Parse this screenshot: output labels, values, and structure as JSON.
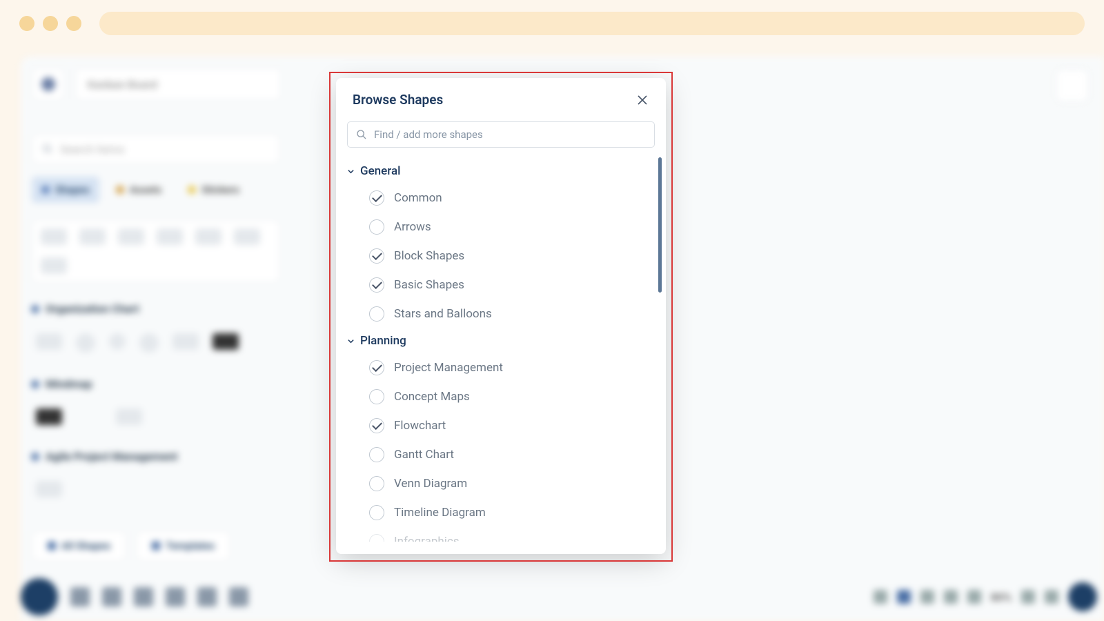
{
  "modal": {
    "title": "Browse Shapes",
    "search_placeholder": "Find / add more shapes",
    "categories": [
      {
        "name": "General",
        "items": [
          {
            "label": "Common",
            "checked": true
          },
          {
            "label": "Arrows",
            "checked": false
          },
          {
            "label": "Block Shapes",
            "checked": true
          },
          {
            "label": "Basic Shapes",
            "checked": true
          },
          {
            "label": "Stars and Balloons",
            "checked": false
          }
        ]
      },
      {
        "name": "Planning",
        "items": [
          {
            "label": "Project Management",
            "checked": true
          },
          {
            "label": "Concept Maps",
            "checked": false
          },
          {
            "label": "Flowchart",
            "checked": true
          },
          {
            "label": "Gantt Chart",
            "checked": false
          },
          {
            "label": "Venn Diagram",
            "checked": false
          },
          {
            "label": "Timeline Diagram",
            "checked": false
          },
          {
            "label": "Infographics",
            "checked": false
          }
        ]
      }
    ]
  },
  "background": {
    "board_title": "Kanban Board",
    "sidebar_search_placeholder": "Search Items",
    "tabs": {
      "shapes": "Shapes",
      "assets": "Assets",
      "stickers": "Stickers"
    },
    "sections": {
      "org_chart": "Organization Chart",
      "mindmap": "Mindmap",
      "agile": "Agile Project Management"
    },
    "buttons": {
      "all_shapes": "All Shapes",
      "templates": "Templates"
    },
    "zoom": "80%"
  }
}
